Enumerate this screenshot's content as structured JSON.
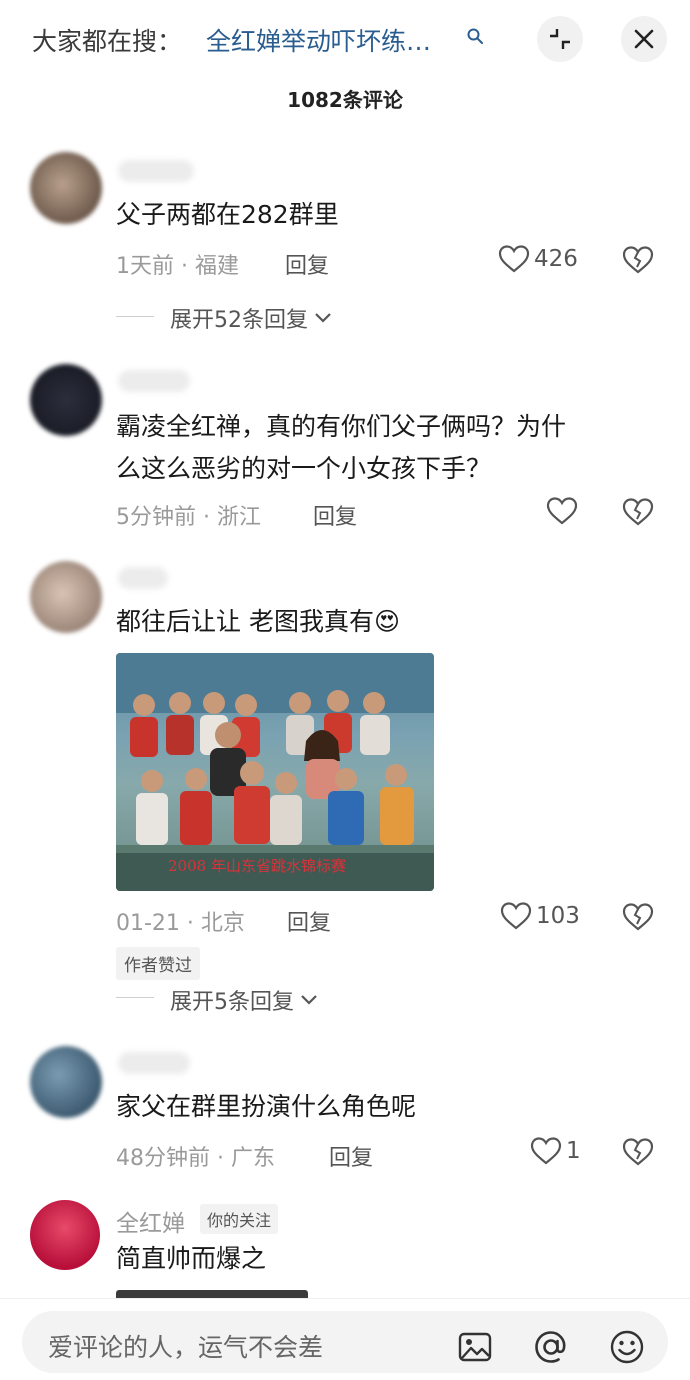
{
  "top": {
    "search_prefix": "大家都在搜：",
    "search_query": "全红婵举动吓坏练…",
    "comment_count": "1082条评论"
  },
  "comments": [
    {
      "text": "父子两都在282群里",
      "time": "1天前",
      "location": "福建",
      "reply_label": "回复",
      "likes": "426",
      "expand": "展开52条回复"
    },
    {
      "text_line1": "霸凌全红禅，真的有你们父子俩吗？为什",
      "text_line2": "么这么恶劣的对一个小女孩下手？",
      "time": "5分钟前",
      "location": "浙江",
      "reply_label": "回复"
    },
    {
      "text": "都往后让让 老图我真有",
      "emoji": "😍",
      "photo_caption": "2008 年山东省跳水锦标赛",
      "time": "01-21",
      "location": "北京",
      "reply_label": "回复",
      "likes": "103",
      "author_badge": "作者赞过",
      "expand": "展开5条回复"
    },
    {
      "text": "家父在群里扮演什么角色呢",
      "time": "48分钟前",
      "location": "广东",
      "reply_label": "回复",
      "likes": "1"
    },
    {
      "name": "全红婵",
      "follow_badge": "你的关注",
      "text": "简直帅而爆之"
    }
  ],
  "bottom": {
    "placeholder": "爱评论的人，运气不会差"
  },
  "colors": {
    "link": "#2a5d8f",
    "meta": "#9a9a9a"
  }
}
